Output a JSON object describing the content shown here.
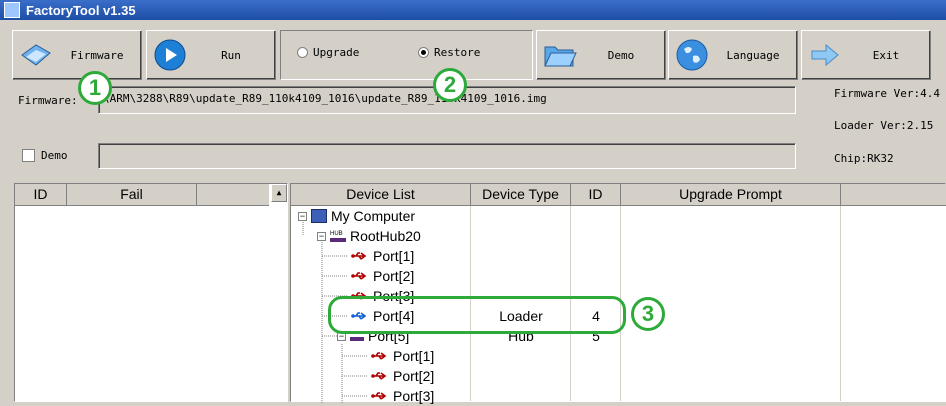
{
  "window": {
    "title": "FactoryTool v1.35"
  },
  "toolbar": {
    "firmware_label": "Firmware",
    "run_label": "Run",
    "upgrade_label": "Upgrade",
    "restore_label": "Restore",
    "demo_label": "Demo",
    "language_label": "Language",
    "exit_label": "Exit",
    "selected_mode": "Restore"
  },
  "firmware_row": {
    "label": "Firmware:",
    "path": "\\ARM\\3288\\R89\\update_R89_110k4109_1016\\update_R89_110k4109_1016.img"
  },
  "demo_row": {
    "label": "Demo",
    "checked": false,
    "path": ""
  },
  "info": {
    "firmware_ver": "Firmware Ver:4.4",
    "loader_ver": "Loader Ver:2.15",
    "chip": "Chip:RK32"
  },
  "fail_table": {
    "headers": [
      "ID",
      "Fail"
    ]
  },
  "device_table": {
    "headers": [
      "Device List",
      "Device Type",
      "ID",
      "Upgrade Prompt"
    ],
    "rows": [
      {
        "name": "My Computer",
        "type": "",
        "id": "",
        "prompt": ""
      },
      {
        "name": "RootHub20",
        "type": "",
        "id": "",
        "prompt": ""
      },
      {
        "name": "Port[1]",
        "type": "",
        "id": "",
        "prompt": ""
      },
      {
        "name": "Port[2]",
        "type": "",
        "id": "",
        "prompt": ""
      },
      {
        "name": "Port[3]",
        "type": "",
        "id": "",
        "prompt": ""
      },
      {
        "name": "Port[4]",
        "type": "Loader",
        "id": "4",
        "prompt": ""
      },
      {
        "name": "Port[5]",
        "type": "Hub",
        "id": "5",
        "prompt": ""
      },
      {
        "name": "Port[1]",
        "type": "",
        "id": "",
        "prompt": ""
      },
      {
        "name": "Port[2]",
        "type": "",
        "id": "",
        "prompt": ""
      },
      {
        "name": "Port[3]",
        "type": "",
        "id": "",
        "prompt": ""
      }
    ]
  },
  "callouts": [
    "1",
    "2",
    "3"
  ],
  "colors": {
    "callout": "#2eaa3a",
    "title_bar": "#1e4ea6",
    "usb_red": "#b00000",
    "usb_blue": "#1060d0"
  }
}
